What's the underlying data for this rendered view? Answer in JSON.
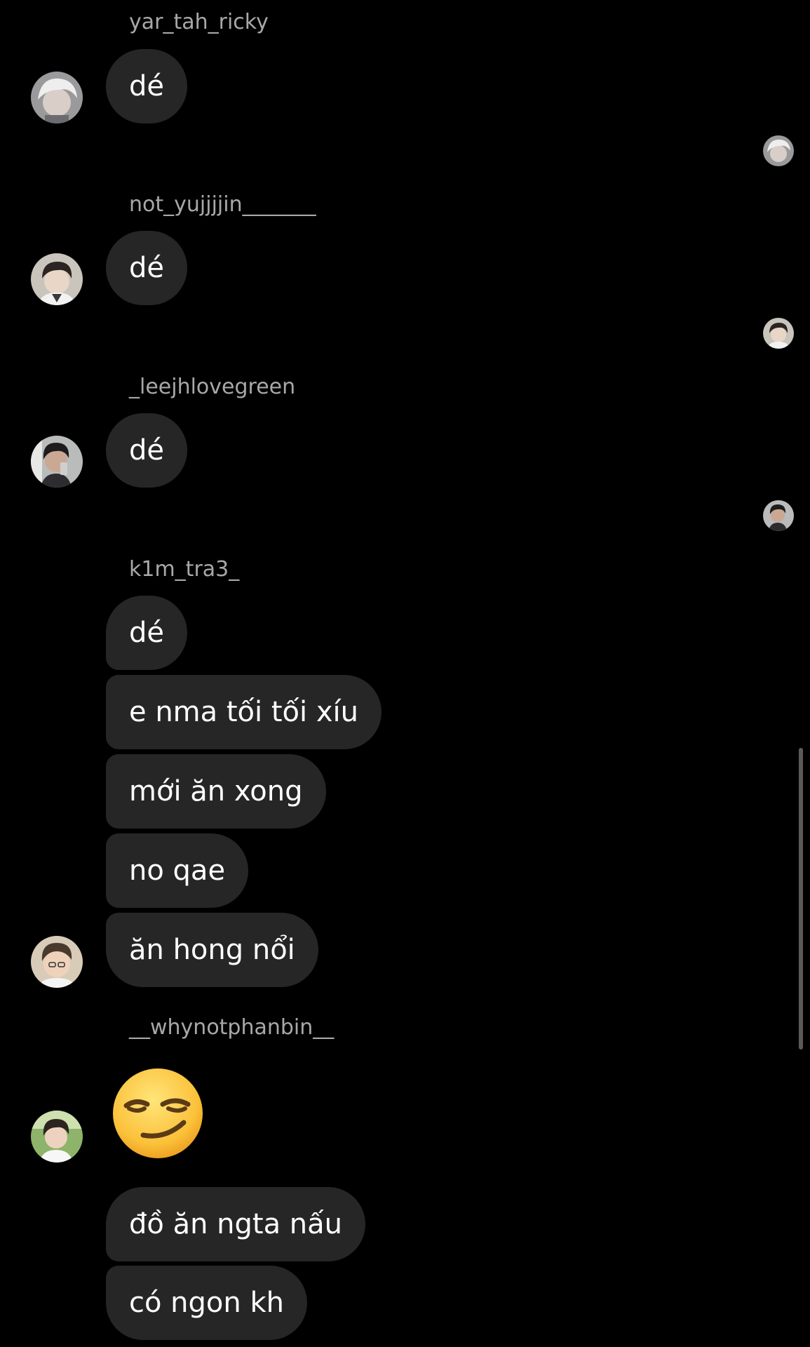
{
  "messages": {
    "m1": {
      "username": "yar_tah_ricky",
      "text": "dé"
    },
    "m2": {
      "username": "not_yujjjjin_______",
      "text": "dé"
    },
    "m3": {
      "username": "_leejhlovegreen",
      "text": "dé"
    },
    "m4": {
      "username": "k1m_tra3_",
      "lines": [
        "dé",
        "e nma tối tối xíu",
        "mới ăn xong",
        "no qae",
        "ăn hong nổi"
      ]
    },
    "m5": {
      "username": "__whynotphanbin__",
      "emoji": "smirking-face",
      "lines": [
        "đồ ăn ngta nấu",
        "có ngon kh"
      ]
    }
  },
  "colors": {
    "background": "#000000",
    "bubble": "#262626",
    "username": "#a8a8a8",
    "text": "#ffffff"
  }
}
